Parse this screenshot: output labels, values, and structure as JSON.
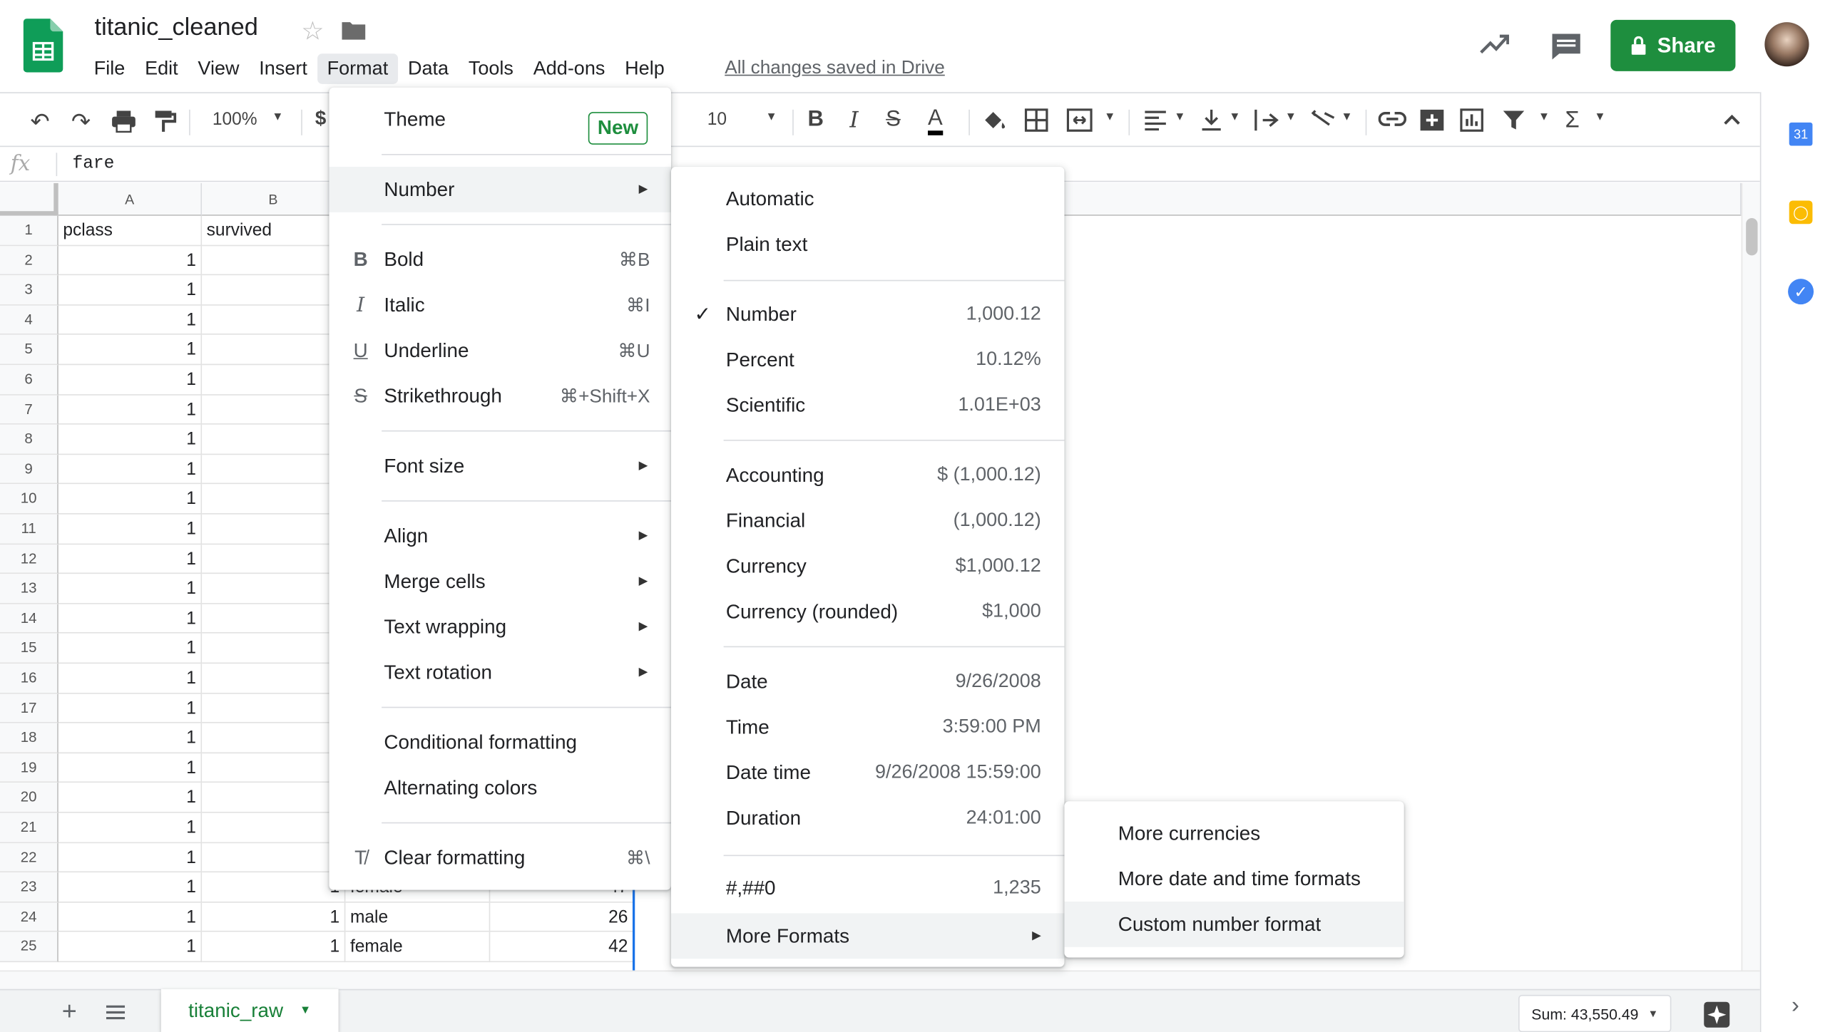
{
  "doc": {
    "title": "titanic_cleaned",
    "saved": "All changes saved in Drive"
  },
  "menubar": [
    "File",
    "Edit",
    "View",
    "Insert",
    "Format",
    "Data",
    "Tools",
    "Add-ons",
    "Help"
  ],
  "share": {
    "label": "Share"
  },
  "toolbar": {
    "zoom": "100%",
    "currency": "$",
    "font_size": "10"
  },
  "formula": {
    "fx": "fx",
    "value": "fare"
  },
  "columns": [
    "A",
    "B"
  ],
  "header_row": {
    "a": "pclass",
    "b": "survived"
  },
  "rows": [
    "1",
    "2",
    "3",
    "4",
    "5",
    "6",
    "7",
    "8",
    "9",
    "10",
    "11",
    "12",
    "13",
    "14",
    "15",
    "16",
    "17",
    "18",
    "19",
    "20",
    "21",
    "22",
    "23",
    "24",
    "25"
  ],
  "visible_rows": [
    {
      "pclass": "1",
      "survived": "1",
      "sex": "female",
      "age": "47"
    },
    {
      "pclass": "1",
      "survived": "1",
      "sex": "male",
      "age": "26"
    },
    {
      "pclass": "1",
      "survived": "1",
      "sex": "female",
      "age": "42"
    }
  ],
  "col_a_value": "1",
  "format_menu": {
    "theme": "Theme",
    "new_badge": "New",
    "number": "Number",
    "bold": "Bold",
    "bold_sc": "⌘B",
    "italic": "Italic",
    "italic_sc": "⌘I",
    "underline": "Underline",
    "underline_sc": "⌘U",
    "strike": "Strikethrough",
    "strike_sc": "⌘+Shift+X",
    "font_size": "Font size",
    "align": "Align",
    "merge": "Merge cells",
    "wrap": "Text wrapping",
    "rotation": "Text rotation",
    "conditional": "Conditional formatting",
    "alternating": "Alternating colors",
    "clear": "Clear formatting",
    "clear_sc": "⌘\\"
  },
  "number_menu": {
    "automatic": "Automatic",
    "plain": "Plain text",
    "items": [
      {
        "label": "Number",
        "example": "1,000.12"
      },
      {
        "label": "Percent",
        "example": "10.12%"
      },
      {
        "label": "Scientific",
        "example": "1.01E+03"
      },
      {
        "label": "Accounting",
        "example": "$ (1,000.12)"
      },
      {
        "label": "Financial",
        "example": "(1,000.12)"
      },
      {
        "label": "Currency",
        "example": "$1,000.12"
      },
      {
        "label": "Currency (rounded)",
        "example": "$1,000"
      },
      {
        "label": "Date",
        "example": "9/26/2008"
      },
      {
        "label": "Time",
        "example": "3:59:00 PM"
      },
      {
        "label": "Date time",
        "example": "9/26/2008 15:59:00"
      },
      {
        "label": "Duration",
        "example": "24:01:00"
      },
      {
        "label": "#,##0",
        "example": "1,235"
      }
    ],
    "more": "More Formats"
  },
  "more_formats_menu": {
    "currencies": "More currencies",
    "datetime": "More date and time formats",
    "custom": "Custom number format"
  },
  "sheet": {
    "tab": "titanic_raw",
    "sum": "Sum: 43,550.49"
  },
  "side": {
    "calendar_day": "31"
  },
  "colors": {
    "accent": "#1e8e3e",
    "sheets_green": "#0f9d58",
    "selection": "#1a73e8"
  }
}
